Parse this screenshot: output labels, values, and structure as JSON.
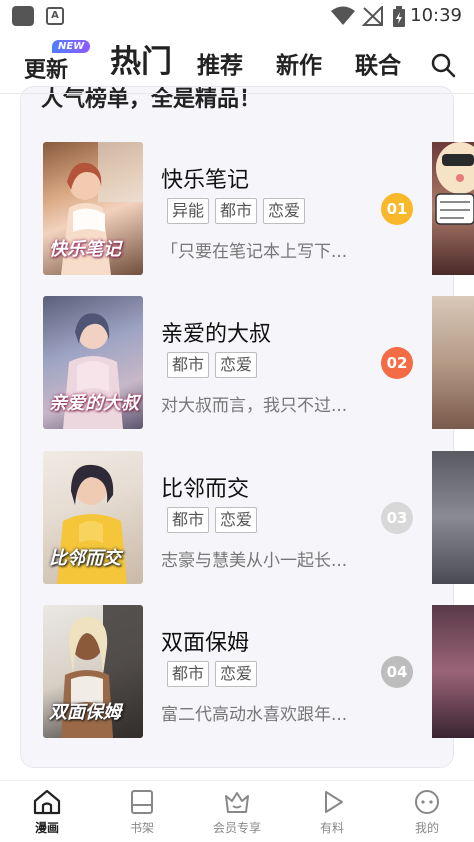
{
  "status_bar": {
    "time": "10:39"
  },
  "tabs": {
    "update": "更新",
    "new_badge": "NEW",
    "hot": "热门",
    "recommend": "推荐",
    "new_works": "新作",
    "joint": "联合"
  },
  "card": {
    "title": "人气榜单，全是精品！",
    "items": [
      {
        "name": "快乐笔记",
        "tags": [
          "异能",
          "都市",
          "恋爱"
        ],
        "desc": "「只要在笔记本上写下...",
        "rank": "01",
        "rank_color": "#f9b72a",
        "cover_text": "快乐笔记"
      },
      {
        "name": "亲爱的大叔",
        "tags": [
          "都市",
          "恋爱"
        ],
        "desc": "对大叔而言，我只不过...",
        "rank": "02",
        "rank_color": "#f36c45",
        "cover_text": "亲爱的大叔"
      },
      {
        "name": "比邻而交",
        "tags": [
          "都市",
          "恋爱"
        ],
        "desc": "志豪与慧美从小一起长...",
        "rank": "03",
        "rank_color": "#d8d8d8",
        "cover_text": "比邻而交"
      },
      {
        "name": "双面保姆",
        "tags": [
          "都市",
          "恋爱"
        ],
        "desc": "富二代高动水喜欢跟年...",
        "rank": "04",
        "rank_color": "#bdbdbd",
        "cover_text": "双面保姆"
      }
    ]
  },
  "nav": {
    "comics": "漫画",
    "bookshelf": "书架",
    "vip": "会员专享",
    "fun": "有料",
    "mine": "我的"
  },
  "colors": {
    "accent": "#222222",
    "rank1": "#f9b72a",
    "rank2": "#f36c45"
  }
}
